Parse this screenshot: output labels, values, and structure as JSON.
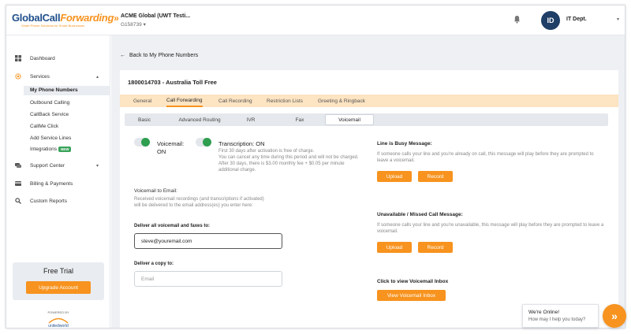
{
  "brand": {
    "name_part1": "Global",
    "name_part2": "Call",
    "name_part3": "Forwarding",
    "tagline": "Smart Phone Solutions for Smart Businesses",
    "accent": "#f7931e",
    "primary": "#1f4f8b"
  },
  "account": {
    "name": "ACME Global (UWT Testi...",
    "id": "G158739"
  },
  "user": {
    "initials": "ID",
    "name": "IT Dept."
  },
  "sidebar": {
    "items": [
      {
        "label": "Dashboard",
        "icon": "dashboard-icon"
      },
      {
        "label": "Services",
        "icon": "gear-icon"
      },
      {
        "label": "Support Center",
        "icon": "support-icon"
      },
      {
        "label": "Billing & Payments",
        "icon": "billing-icon"
      },
      {
        "label": "Custom Reports",
        "icon": "search-icon"
      }
    ],
    "services_sub": [
      "My Phone Numbers",
      "Outbound Calling",
      "CallBack Service",
      "CallMe Click",
      "Add Service Lines",
      "Integrations"
    ],
    "new_badge": "NEW",
    "trial_title": "Free Trial",
    "upgrade_label": "Upgrade Account",
    "powered_by": "POWERED BY",
    "partner_logo_text": "unitedworld"
  },
  "main": {
    "back_label": "Back to My Phone Numbers",
    "number_title": "1800014703 - Australia Toll Free",
    "tabs": [
      "General",
      "Call Forwarding",
      "Call Recording",
      "Restriction Lists",
      "Greeting & Ringback"
    ],
    "active_tab": "Call Forwarding",
    "subtabs": [
      "Basic",
      "Advanced Routing",
      "IVR",
      "Fax",
      "Voicemail"
    ],
    "active_subtab": "Voicemail",
    "voicemail": {
      "label_line1": "Voicemail:",
      "label_line2": "ON"
    },
    "transcription": {
      "label": "Transcription: ON",
      "desc1": "First 30 days after activation is free of charge.",
      "desc2": "You can cancel any time during this period and will not be charged.",
      "desc3": "After 30 days, there is $3.00 monthly fee + $0.05 per minute",
      "desc4": "additional charge."
    },
    "email_section": {
      "title": "Voicemail to Email:",
      "desc1": "Received voicemail recordings (and transcriptions if activated)",
      "desc2": "will be delivered to the email address(es) you enter here:",
      "deliver_label": "Deliver all voicemail and faxes to:",
      "deliver_value": "steve@youremail.com",
      "copy_label": "Deliver a copy to:",
      "copy_placeholder": "Email"
    },
    "busy": {
      "title": "Line is Busy Message:",
      "desc1": "If someone calls your line and you're already on call, this message will play before they are prompted to",
      "desc2": "leave a voicemail.",
      "upload": "Upload",
      "record": "Record"
    },
    "unavailable": {
      "title": "Unavailable / Missed Call Message:",
      "desc1": "If someone calls your line and you're unavailable, this message will play before they are prompted to leave a",
      "desc2": "voicemail.",
      "upload": "Upload",
      "record": "Record"
    },
    "inbox": {
      "title": "Click to view Voicemail Inbox",
      "button": "View Voicemail Inbox"
    }
  },
  "chat": {
    "title": "We're Online!",
    "subtitle": "How may I help you today?"
  }
}
